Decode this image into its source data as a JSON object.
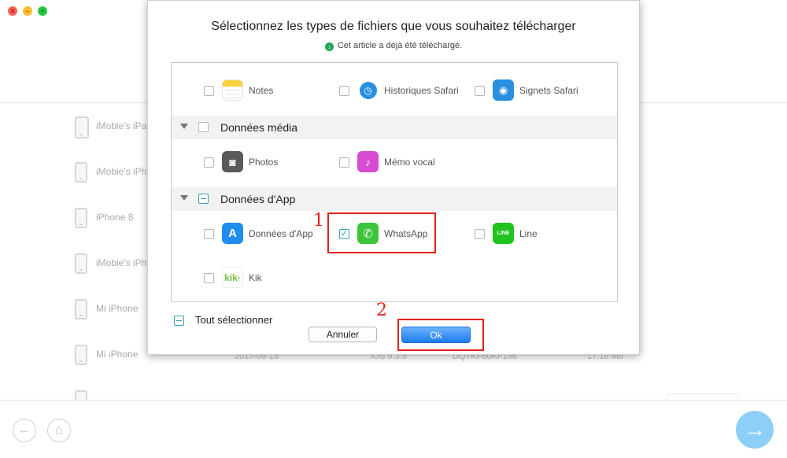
{
  "background": {
    "devices": [
      {
        "name": "iMobie's iPa",
        "date": "",
        "ios": "",
        "serial": "",
        "time": ""
      },
      {
        "name": "iMobie's iPh",
        "date": "",
        "ios": "",
        "serial": "",
        "time": ""
      },
      {
        "name": "iPhone 8",
        "date": "",
        "ios": "",
        "serial": "",
        "time": ""
      },
      {
        "name": "iMobie's iPh",
        "date": "",
        "ios": "",
        "serial": "",
        "time": ""
      },
      {
        "name": "Mi iPhone",
        "date": "",
        "ios": "",
        "serial": "",
        "time": ""
      },
      {
        "name": "Mi iPhone",
        "date": "2017-09-18",
        "ios": "iOS 9.3.5",
        "serial": "DQTKF80KF196",
        "time": "17:18 Mo"
      }
    ]
  },
  "dialog": {
    "title": "Sélectionnez les types de fichiers que vous souhaitez télécharger",
    "subtitle": "Cet article a déjà été téléchargé.",
    "categories": [
      {
        "label": "Données média",
        "state": "unchecked"
      },
      {
        "label": "Données d'App",
        "state": "partial"
      }
    ],
    "items": {
      "notes": {
        "label": "Notes",
        "checked": false,
        "icon": "notes-icon"
      },
      "safari_history": {
        "label": "Historiques Safari",
        "checked": false,
        "icon": "safari-history-icon"
      },
      "safari_bookmarks": {
        "label": "Signets Safari",
        "checked": false,
        "icon": "safari-bookmarks-icon"
      },
      "photos": {
        "label": "Photos",
        "checked": false,
        "icon": "camera-icon"
      },
      "voice_memo": {
        "label": "Mémo vocal",
        "checked": false,
        "icon": "microphone-icon"
      },
      "app_data": {
        "label": "Données d'App",
        "checked": false,
        "icon": "app-store-icon"
      },
      "whatsapp": {
        "label": "WhatsApp",
        "checked": true,
        "icon": "whatsapp-icon"
      },
      "line": {
        "label": "Line",
        "checked": false,
        "icon": "line-icon"
      },
      "kik": {
        "label": "Kik",
        "checked": false,
        "icon": "kik-icon"
      }
    },
    "select_all_label": "Tout sélectionner",
    "cancel_label": "Annuler",
    "ok_label": "Ok"
  },
  "annotations": {
    "step1": "1",
    "step2": "2",
    "color": "#e0231c"
  },
  "icon_glyphs": {
    "line": "LINE",
    "kik": "kik·"
  }
}
